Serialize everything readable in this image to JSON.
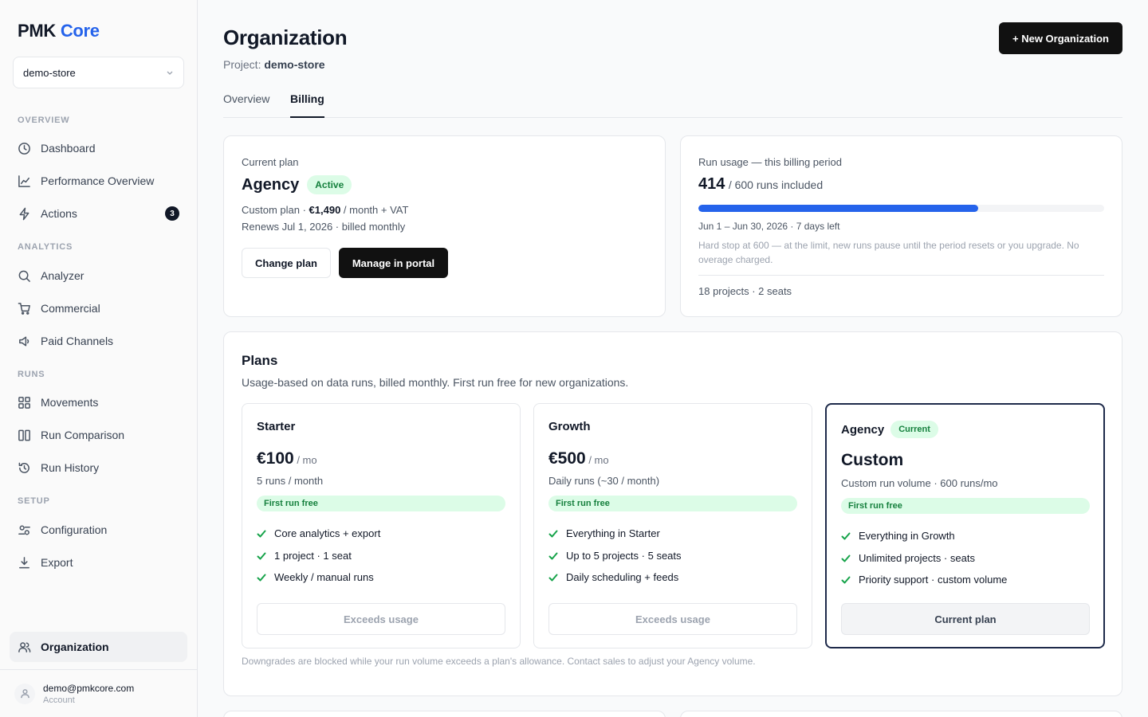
{
  "sidebar": {
    "logo_main": "PMK",
    "logo_accent": "Core",
    "project_select": "demo-store",
    "sections": {
      "overview": "OVERVIEW",
      "analytics": "ANALYTICS",
      "runs": "RUNS",
      "setup": "SETUP"
    },
    "items": {
      "dashboard": "Dashboard",
      "performance": "Performance Overview",
      "actions": "Actions",
      "actions_badge": "3",
      "analyzer": "Analyzer",
      "commercial": "Commercial",
      "paid_channels": "Paid Channels",
      "movements": "Movements",
      "run_comparison": "Run Comparison",
      "run_history": "Run History",
      "configuration": "Configuration",
      "export": "Export",
      "organization": "Organization"
    },
    "account": {
      "email": "demo@pmkcore.com",
      "label": "Account"
    }
  },
  "header": {
    "title": "Organization",
    "project_prefix": "Project:",
    "project_name": "demo-store",
    "new_org_button": "+ New Organization"
  },
  "tabs": {
    "overview": "Overview",
    "billing": "Billing"
  },
  "current_plan": {
    "label": "Current plan",
    "name": "Agency",
    "status": "Active",
    "price_prefix": "Custom plan · ",
    "price": "€1,490",
    "price_suffix": " / month + VAT",
    "renewal": "Renews Jul 1, 2026 · billed monthly",
    "change_button": "Change plan",
    "portal_button": "Manage in portal"
  },
  "usage": {
    "label": "Run usage — this billing period",
    "used": "414",
    "included_text": "/ 600 runs included",
    "fraction": 0.69,
    "period": "Jun 1 – Jun 30, 2026 · 7 days left",
    "note": "Hard stop at 600 — at the limit, new runs pause until the period resets or you upgrade. No overage charged.",
    "footer": "18 projects · 2 seats"
  },
  "plans": {
    "title": "Plans",
    "subtitle": "Usage-based on data runs, billed monthly. First run free for new organizations.",
    "footnote": "Downgrades are blocked while your run volume exceeds a plan's allowance. Contact sales to adjust your Agency volume.",
    "starter": {
      "name": "Starter",
      "price": "€100",
      "per": " / mo",
      "desc": "5 runs / month",
      "free": "First run free",
      "features": [
        "Core analytics + export",
        "1 project · 1 seat",
        "Weekly / manual runs"
      ],
      "button": "Exceeds usage"
    },
    "growth": {
      "name": "Growth",
      "price": "€500",
      "per": " / mo",
      "desc": "Daily runs (~30 / month)",
      "free": "First run free",
      "features": [
        "Everything in Starter",
        "Up to 5 projects · 5 seats",
        "Daily scheduling + feeds"
      ],
      "button": "Exceeds usage"
    },
    "agency": {
      "name": "Agency",
      "badge": "Current",
      "price": "Custom",
      "desc": "Custom run volume · 600 runs/mo",
      "free": "First run free",
      "features": [
        "Everything in Growth",
        "Unlimited projects · seats",
        "Priority support · custom volume"
      ],
      "button": "Current plan"
    }
  }
}
